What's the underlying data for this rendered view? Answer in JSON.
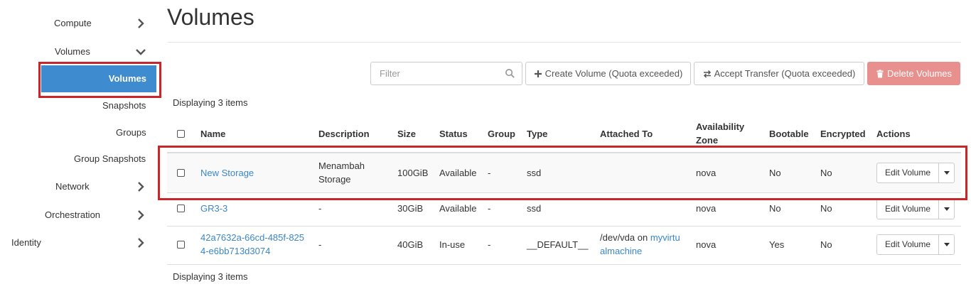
{
  "sidebar": {
    "compute": "Compute",
    "volumes": "Volumes",
    "volumes_active": "Volumes",
    "snapshots": "Snapshots",
    "groups": "Groups",
    "group_snapshots": "Group Snapshots",
    "network": "Network",
    "orchestration": "Orchestration",
    "identity": "Identity"
  },
  "page": {
    "title": "Volumes"
  },
  "toolbar": {
    "filter_placeholder": "Filter",
    "create_label": "Create Volume (Quota exceeded)",
    "accept_label": "Accept Transfer (Quota exceeded)",
    "delete_label": "Delete Volumes"
  },
  "table": {
    "count_text": "Displaying 3 items",
    "headers": {
      "name": "Name",
      "description": "Description",
      "size": "Size",
      "status": "Status",
      "group": "Group",
      "type": "Type",
      "attached_to": "Attached To",
      "availability_zone_1": "Availability",
      "availability_zone_2": "Zone",
      "bootable": "Bootable",
      "encrypted": "Encrypted",
      "actions": "Actions"
    },
    "rows": [
      {
        "name": "New Storage",
        "description_1": "Menambah",
        "description_2": "Storage",
        "size": "100GiB",
        "status": "Available",
        "group": "-",
        "type": "ssd",
        "zone": "nova",
        "bootable": "No",
        "encrypted": "No",
        "action": "Edit Volume"
      },
      {
        "name": "GR3-3",
        "description": "-",
        "size": "30GiB",
        "status": "Available",
        "group": "-",
        "type": "ssd",
        "zone": "nova",
        "bootable": "No",
        "encrypted": "No",
        "action": "Edit Volume"
      },
      {
        "name_1": "42a7632a-66cd-485f-825",
        "name_2": "4-e6bb713d3074",
        "description": "-",
        "size": "40GiB",
        "status": "In-use",
        "group": "-",
        "type": "__DEFAULT__",
        "attached_prefix": "/dev/vda on",
        "attached_link_1": "myvirtu",
        "attached_link_2": "almachine",
        "zone": "nova",
        "bootable": "Yes",
        "encrypted": "No",
        "action": "Edit Volume"
      }
    ]
  },
  "colors": {
    "primary": "#3e8bd0",
    "danger_disabled": "#e8908d",
    "highlight": "#c9262c",
    "link": "#3a87c8"
  }
}
